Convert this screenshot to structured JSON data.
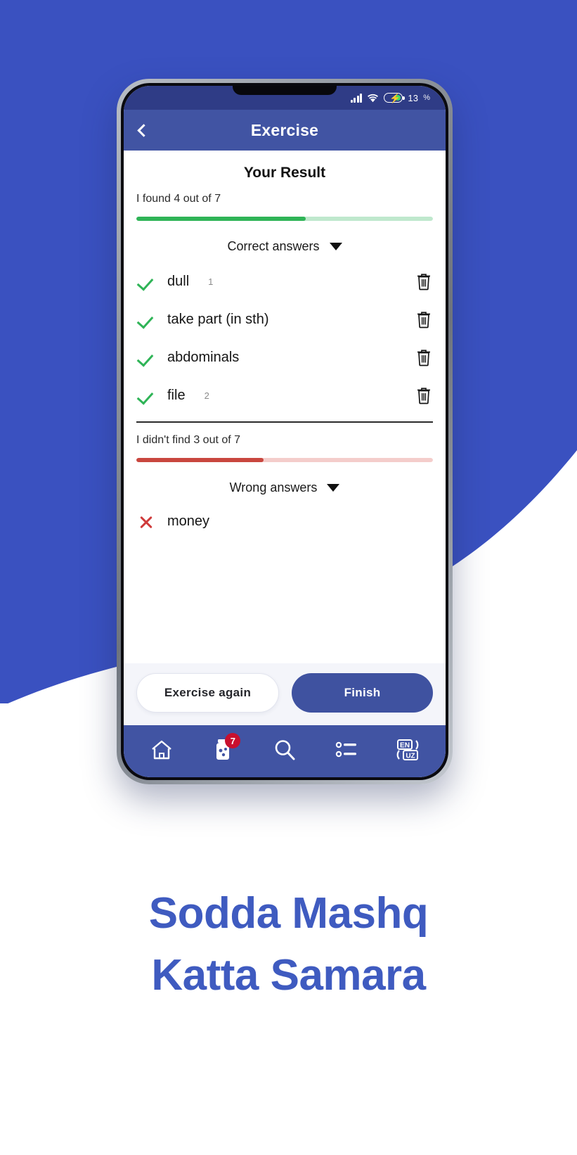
{
  "accent_colors": {
    "brand_blue": "#3f52a0",
    "bg_blue": "#3a51c0",
    "headline_blue": "#3f5bc0",
    "green": "#2fb457",
    "green_track": "#bfe8cd",
    "red": "#c9473f",
    "red_track": "#f4cdcb",
    "badge_red": "#c8102e",
    "statusbar_blue": "#2f3c86",
    "appbar_blue": "#4154a3"
  },
  "statusbar": {
    "signal_icon": "signal-bars-icon",
    "wifi_icon": "wifi-icon",
    "battery_icon": "battery-charging-icon",
    "battery_level": "13",
    "battery_unit": "%"
  },
  "appbar": {
    "back_icon": "back-chevron-icon",
    "title": "Exercise"
  },
  "result": {
    "title": "Your Result",
    "correct": {
      "summary": "I found 4 out of 7",
      "progress_percent": 57,
      "collapse_label": "Correct answers",
      "caret_icon": "chevron-down-icon",
      "items": [
        {
          "status_icon": "check-icon",
          "word": "dull",
          "count": "1",
          "delete_icon": "trash-icon"
        },
        {
          "status_icon": "check-icon",
          "word": "take part (in sth)",
          "count": "",
          "delete_icon": "trash-icon"
        },
        {
          "status_icon": "check-icon",
          "word": "abdominals",
          "count": "",
          "delete_icon": "trash-icon"
        },
        {
          "status_icon": "check-icon",
          "word": "file",
          "count": "2",
          "delete_icon": "trash-icon"
        }
      ]
    },
    "wrong": {
      "summary": "I didn't find 3 out of 7",
      "progress_percent": 43,
      "collapse_label": "Wrong answers",
      "caret_icon": "chevron-down-icon",
      "items": [
        {
          "status_icon": "x-icon",
          "word": "money",
          "count": ""
        }
      ]
    }
  },
  "footer": {
    "secondary_label": "Exercise again",
    "primary_label": "Finish"
  },
  "navbar": {
    "items": [
      {
        "icon": "home-icon",
        "badge": ""
      },
      {
        "icon": "jar-icon",
        "badge": "7"
      },
      {
        "icon": "search-icon",
        "badge": ""
      },
      {
        "icon": "list-icon",
        "badge": ""
      },
      {
        "icon": "language-en-uz-icon",
        "badge": ""
      }
    ]
  },
  "promo": {
    "line1": "Sodda Mashq",
    "line2": "Katta Samara"
  }
}
